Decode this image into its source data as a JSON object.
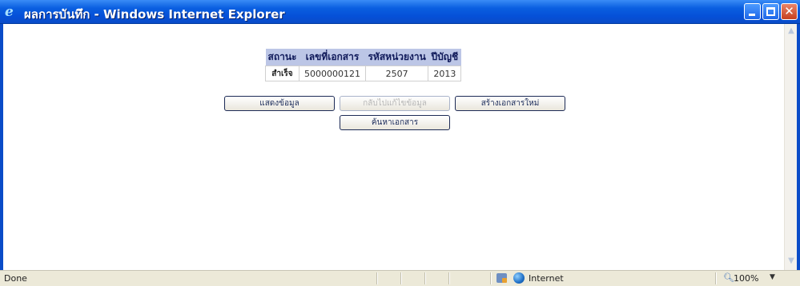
{
  "window": {
    "title": "ผลการบันทึก - Windows Internet Explorer",
    "icon": "ie-logo-icon"
  },
  "result_table": {
    "headers": [
      "สถานะ",
      "เลขที่เอกสาร",
      "รหัสหน่วยงาน",
      "ปีบัญชี"
    ],
    "rows": [
      [
        "สำเร็จ",
        "5000000121",
        "2507",
        "2013"
      ]
    ]
  },
  "buttons": {
    "show_data": "แสดงข้อมูล",
    "back_edit": "กลับไปแก้ไขข้อมูล",
    "create_new": "สร้างเอกสารใหม่",
    "search_doc": "ค้นหาเอกสาร"
  },
  "statusbar": {
    "status": "Done",
    "zone": "Internet",
    "zoom": "100%"
  },
  "colors": {
    "titlebar": "#0550d8",
    "table_header": "#bcc6e6"
  }
}
